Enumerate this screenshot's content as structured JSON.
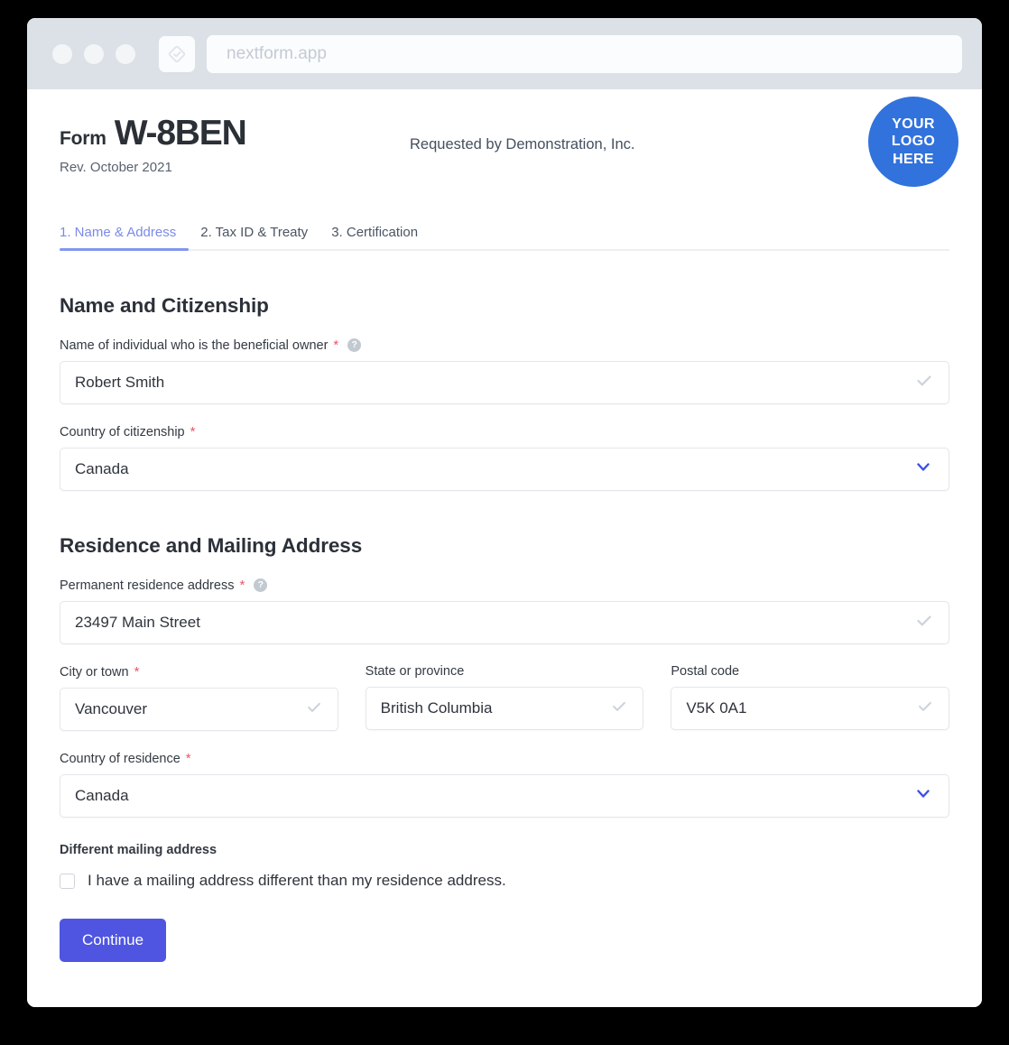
{
  "browser": {
    "dots": [
      "dot-1",
      "dot-2",
      "dot-3"
    ],
    "app_icon": "diamond-outline-icon",
    "url": "nextform.app"
  },
  "header": {
    "form_word": "Form",
    "form_code": "W-8BEN",
    "revision": "Rev. October 2021",
    "requested_by": "Requested by Demonstration, Inc.",
    "logo_line1": "YOUR",
    "logo_line2": "LOGO",
    "logo_line3": "HERE",
    "logo_color": "#3272dc"
  },
  "tabs": [
    {
      "label": "1. Name & Address",
      "active": true
    },
    {
      "label": "2. Tax ID & Treaty",
      "active": false
    },
    {
      "label": "3. Certification",
      "active": false
    }
  ],
  "sections": {
    "name_citizenship": {
      "title": "Name and Citizenship",
      "beneficial_owner": {
        "label": "Name of individual who is the beneficial owner",
        "required_marker": "*",
        "help_icon": "?",
        "value": "Robert Smith",
        "placeholder": "",
        "valid_icon": "check-icon"
      },
      "country_citizenship": {
        "label": "Country of citizenship",
        "required_marker": "*",
        "value": "Canada",
        "chevron_icon": "chevron-down-icon"
      }
    },
    "residence_mailing": {
      "title": "Residence and Mailing Address",
      "permanent_address": {
        "label": "Permanent residence address",
        "required_marker": "*",
        "help_icon": "?",
        "value": "23497 Main Street",
        "valid_icon": "check-icon"
      },
      "city": {
        "label": "City or town",
        "required_marker": "*",
        "value": "Vancouver",
        "valid_icon": "check-icon"
      },
      "state": {
        "label": "State or province",
        "required_marker": "",
        "value": "British Columbia",
        "valid_icon": "check-icon"
      },
      "postal": {
        "label": "Postal code",
        "required_marker": "",
        "value": "V5K 0A1",
        "valid_icon": "check-icon"
      },
      "country_residence": {
        "label": "Country of residence",
        "required_marker": "*",
        "value": "Canada",
        "chevron_icon": "chevron-down-icon"
      },
      "mailing_group_label": "Different mailing address",
      "mailing_checkbox_label": "I have a mailing address different than my residence address.",
      "mailing_checked": false
    }
  },
  "actions": {
    "continue_label": "Continue",
    "continue_color": "#4f55e0"
  }
}
